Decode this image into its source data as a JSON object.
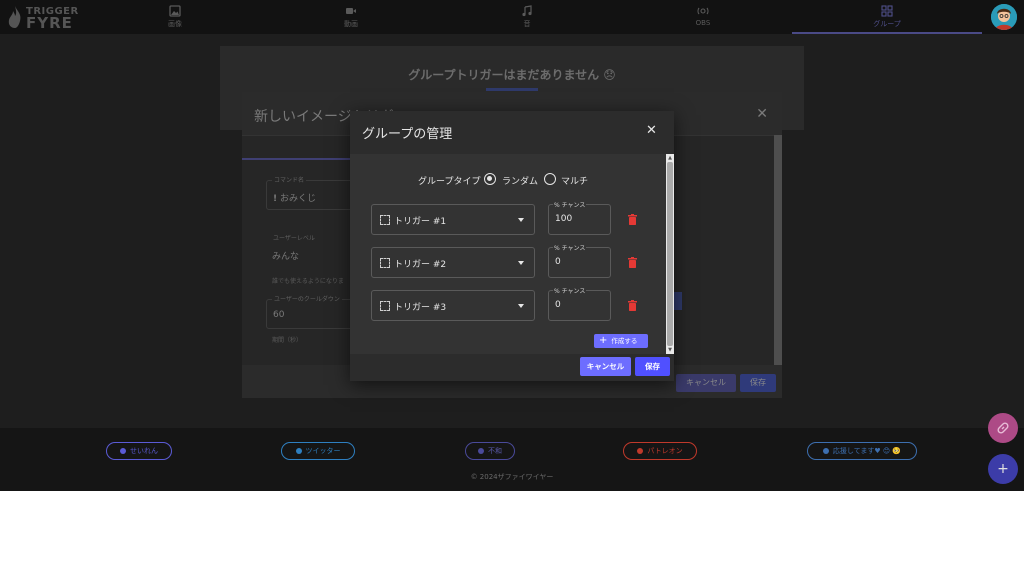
{
  "app": {
    "logo_line1": "TRIGGER",
    "logo_line2": "FYRE"
  },
  "nav": {
    "tabs": [
      {
        "label": "画像",
        "icon": "image-icon"
      },
      {
        "label": "動画",
        "icon": "video-icon"
      },
      {
        "label": "音",
        "icon": "music-note-icon"
      },
      {
        "label": "OBS",
        "icon": "obs-icon"
      },
      {
        "label": "グループ",
        "icon": "group-icon",
        "active": true
      }
    ]
  },
  "groups_page": {
    "empty_message": "グループトリガーはまだありません 😞"
  },
  "image_dialog": {
    "title": "新しいイメージトリガ",
    "command_label": "コマンド名",
    "command_prefix": "!",
    "command_value": "おみくじ",
    "level_label": "ユーザーレベル",
    "level_value": "みんな",
    "level_hint": "誰でも使えるようになりま",
    "cooldown_label": "ユーザーのクールダウン",
    "cooldown_value": "60",
    "cooldown_hint": "期間（秒）",
    "cancel_label": "キャンセル",
    "save_label": "保存"
  },
  "footer": {
    "links": [
      {
        "label": "せいれん",
        "color": "#5b5bd6"
      },
      {
        "label": "ツイッター",
        "color": "#2e7fc0"
      },
      {
        "label": "不和",
        "color": "#4a4a9a"
      },
      {
        "label": "パトレオン",
        "color": "#c0392b"
      },
      {
        "label": "応援してます♥ 😊 🥺",
        "color": "#3d6fb0"
      }
    ],
    "copyright": "© 2024ザファイワイヤー"
  },
  "fabs": {
    "link_icon": "link-icon",
    "add_icon": "plus-icon"
  },
  "modal": {
    "title": "グループの管理",
    "group_type_label": "グループタイプ",
    "options": [
      "ランダム",
      "マルチ"
    ],
    "selected_option": "ランダム",
    "chance_label": "% チャンス",
    "triggers": [
      {
        "name": "トリガー #1",
        "chance": "100"
      },
      {
        "name": "トリガー #2",
        "chance": "0"
      },
      {
        "name": "トリガー #3",
        "chance": "0"
      }
    ],
    "create_label": "作成する",
    "cancel_label": "キャンセル",
    "save_label": "保存"
  },
  "colors": {
    "accent": "#6d6dff",
    "danger": "#e53935",
    "fab_link": "#ad4a86",
    "fab_add": "#3c3ca8"
  }
}
